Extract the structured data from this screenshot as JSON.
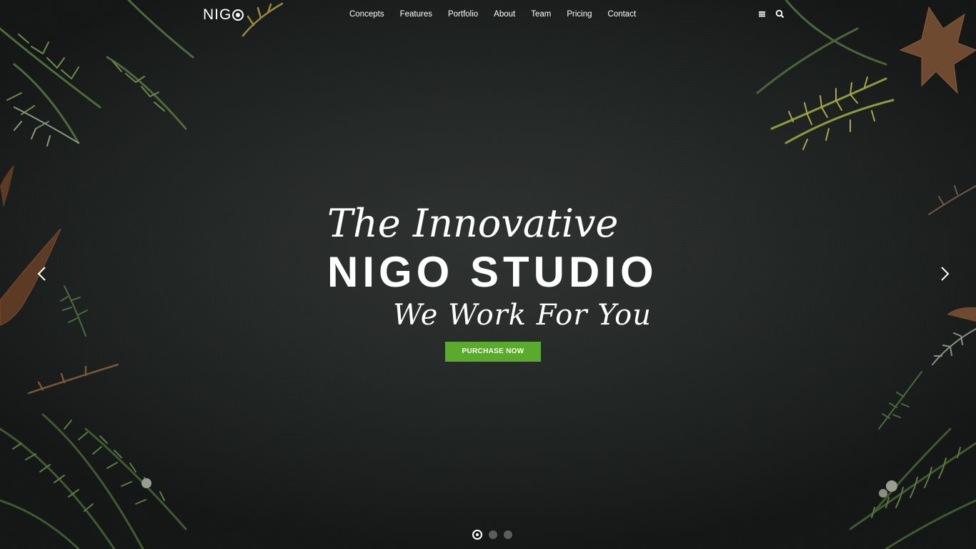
{
  "header": {
    "logo_text": "NIG",
    "nav": [
      {
        "label": "Concepts"
      },
      {
        "label": "Features"
      },
      {
        "label": "Portfolio"
      },
      {
        "label": "About"
      },
      {
        "label": "Team"
      },
      {
        "label": "Pricing"
      },
      {
        "label": "Contact"
      }
    ],
    "icons": [
      "menu-icon",
      "search-icon"
    ]
  },
  "hero": {
    "line1": "The Innovative",
    "line2": "NIGO STUDIO",
    "line3": "We Work For You",
    "cta_label": "PURCHASE NOW",
    "slides_total": 3,
    "active_slide": 1
  },
  "colors": {
    "accent": "#5aaa2e",
    "background": "#262a29",
    "text": "#ffffff"
  }
}
